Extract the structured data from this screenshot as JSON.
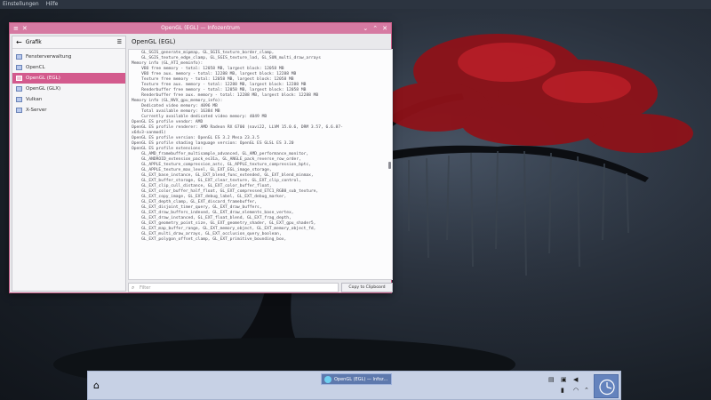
{
  "menubar": {
    "items": [
      "Einstellungen",
      "Hilfe"
    ]
  },
  "window": {
    "title": "OpenGL (EGL) — Infozentrum",
    "controls": {
      "menu": "≡",
      "pin": "✕",
      "minimize": "⌄",
      "maximize": "⌃",
      "close": "✕"
    }
  },
  "sidebar": {
    "back_label": "Grafik",
    "items": [
      {
        "label": "Fensterverwaltung"
      },
      {
        "label": "OpenCL"
      },
      {
        "label": "OpenGL (EGL)"
      },
      {
        "label": "OpenGL (GLX)"
      },
      {
        "label": "Vulkan"
      },
      {
        "label": "X-Server"
      }
    ]
  },
  "main": {
    "title": "OpenGL (EGL)",
    "info_lines": [
      "    GL_SGIS_generate_mipmap, GL_SGIS_texture_border_clamp,",
      "    GL_SGIS_texture_edge_clamp, GL_SGIS_texture_lod, GL_SUN_multi_draw_arrays",
      "Memory info (GL_ATI_meminfo):",
      "    VBO free memory - total: 12058 MB, largest block: 12058 MB",
      "    VBO free aux. memory - total: 12288 MB, largest block: 12288 MB",
      "    Texture free memory - total: 12058 MB, largest block: 12058 MB",
      "    Texture free aux. memory - total: 12288 MB, largest block: 12288 MB",
      "    Renderbuffer free memory - total: 12058 MB, largest block: 12058 MB",
      "    Renderbuffer free aux. memory - total: 12288 MB, largest block: 12288 MB",
      "Memory info (GL_NVX_gpu_memory_info):",
      "    Dedicated video memory: 4096 MB",
      "    Total available memory: 16384 MB",
      "    Currently available dedicated video memory: 4049 MB",
      "OpenGL ES profile vendor: AMD",
      "OpenGL ES profile renderer: AMD Radeon RX 6700 (navi22, LLVM 15.0.6, DRM 3.57, 6.6.87-",
      "x64v3-xanmod1)",
      "OpenGL ES profile version: OpenGL ES 3.2 Mesa 23.3.5",
      "OpenGL ES profile shading language version: OpenGL ES GLSL ES 3.20",
      "OpenGL ES profile extensions:",
      "    GL_AMD_framebuffer_multisample_advanced, GL_AMD_performance_monitor,",
      "    GL_ANDROID_extension_pack_es31a, GL_ANGLE_pack_reverse_row_order,",
      "    GL_APPLE_texture_compression_astc, GL_APPLE_texture_compression_bptc,",
      "    GL_APPLE_texture_max_level, GL_EXT_EGL_image_storage,",
      "    GL_EXT_base_instance, GL_EXT_blend_func_extended, GL_EXT_blend_minmax,",
      "    GL_EXT_buffer_storage, GL_EXT_clear_texture, GL_EXT_clip_control,",
      "    GL_EXT_clip_cull_distance, GL_EXT_color_buffer_float,",
      "    GL_EXT_color_buffer_half_float, GL_EXT_compressed_ETC1_RGB8_sub_texture,",
      "    GL_EXT_copy_image, GL_EXT_debug_label, GL_EXT_debug_marker,",
      "    GL_EXT_depth_clamp, GL_EXT_discard_framebuffer,",
      "    GL_EXT_disjoint_timer_query, GL_EXT_draw_buffers,",
      "    GL_EXT_draw_buffers_indexed, GL_EXT_draw_elements_base_vertex,",
      "    GL_EXT_draw_instanced, GL_EXT_float_blend, GL_EXT_frag_depth,",
      "    GL_EXT_geometry_point_size, GL_EXT_geometry_shader, GL_EXT_gpu_shader5,",
      "    GL_EXT_map_buffer_range, GL_EXT_memory_object, GL_EXT_memory_object_fd,",
      "    GL_EXT_multi_draw_arrays, GL_EXT_occlusion_query_boolean,",
      "    GL_EXT_polygon_offset_clamp, GL_EXT_primitive_bounding_box,"
    ],
    "filter_placeholder": "Filter",
    "copy_button": "Copy to Clipboard"
  },
  "taskbar": {
    "task_label": "OpenGL (EGL) — Infoz..."
  },
  "colors": {
    "accent": "#d35a8d",
    "titlebar": "#d67aa2",
    "taskbar": "#c7d1e5"
  }
}
